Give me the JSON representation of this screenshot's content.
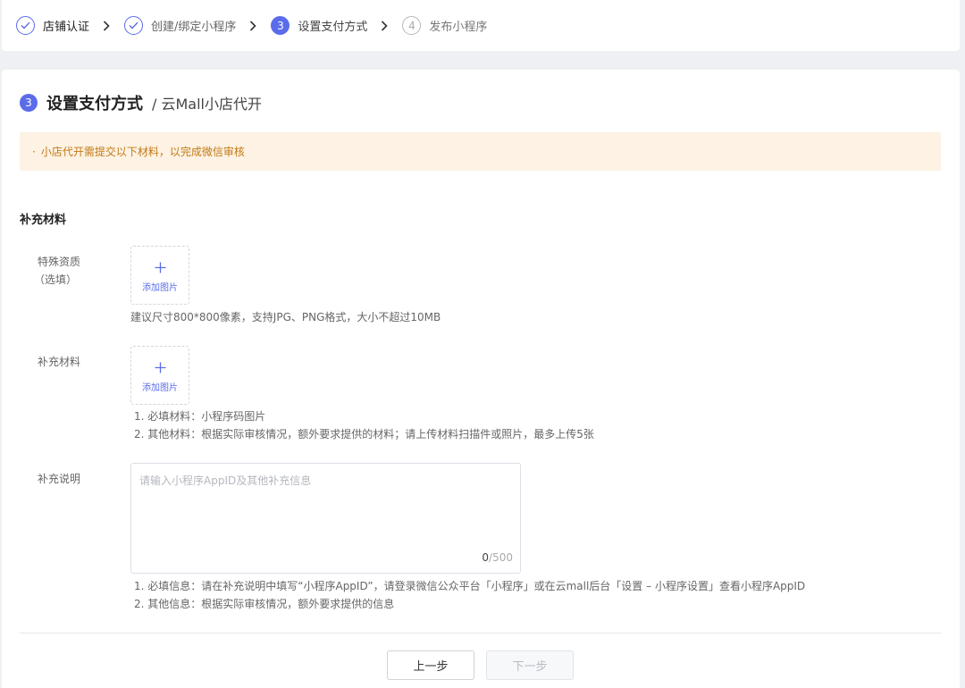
{
  "steps": [
    {
      "label": "店铺认证",
      "status": "done"
    },
    {
      "label": "创建/绑定小程序",
      "status": "done"
    },
    {
      "label": "设置支付方式",
      "status": "active",
      "number": "3"
    },
    {
      "label": "发布小程序",
      "status": "todo",
      "number": "4"
    }
  ],
  "page": {
    "step_number": "3",
    "title": "设置支付方式",
    "subtitle": "/ 云Mall小店代开"
  },
  "notice": {
    "bullet": "·",
    "text": "小店代开需提交以下材料，以完成微信审核"
  },
  "section": {
    "title": "补充材料"
  },
  "fields": {
    "special": {
      "label_line1": "特殊资质",
      "label_line2": "（选填）",
      "upload_label": "添加图片",
      "hint": "建议尺寸800*800像素，支持JPG、PNG格式，大小不超过10MB"
    },
    "material": {
      "label": "补充材料",
      "upload_label": "添加图片",
      "hints": [
        "1. 必填材料：小程序码图片",
        "2. 其他材料：根据实际审核情况，额外要求提供的材料；请上传材料扫描件或照片，最多上传5张"
      ]
    },
    "description": {
      "label": "补充说明",
      "placeholder": "请输入小程序AppID及其他补充信息",
      "count": "0",
      "max": "/500",
      "hints": [
        "1. 必填信息：请在补充说明中填写“小程序AppID”，请登录微信公众平台「小程序」或在云mall后台「设置 – 小程序设置」查看小程序AppID",
        "2. 其他信息：根据实际审核情况，额外要求提供的信息"
      ]
    }
  },
  "buttons": {
    "prev": "上一步",
    "next": "下一步"
  },
  "colors": {
    "accent": "#5a6cea",
    "notice_bg": "#fdf2e3",
    "notice_text": "#c27a16"
  }
}
